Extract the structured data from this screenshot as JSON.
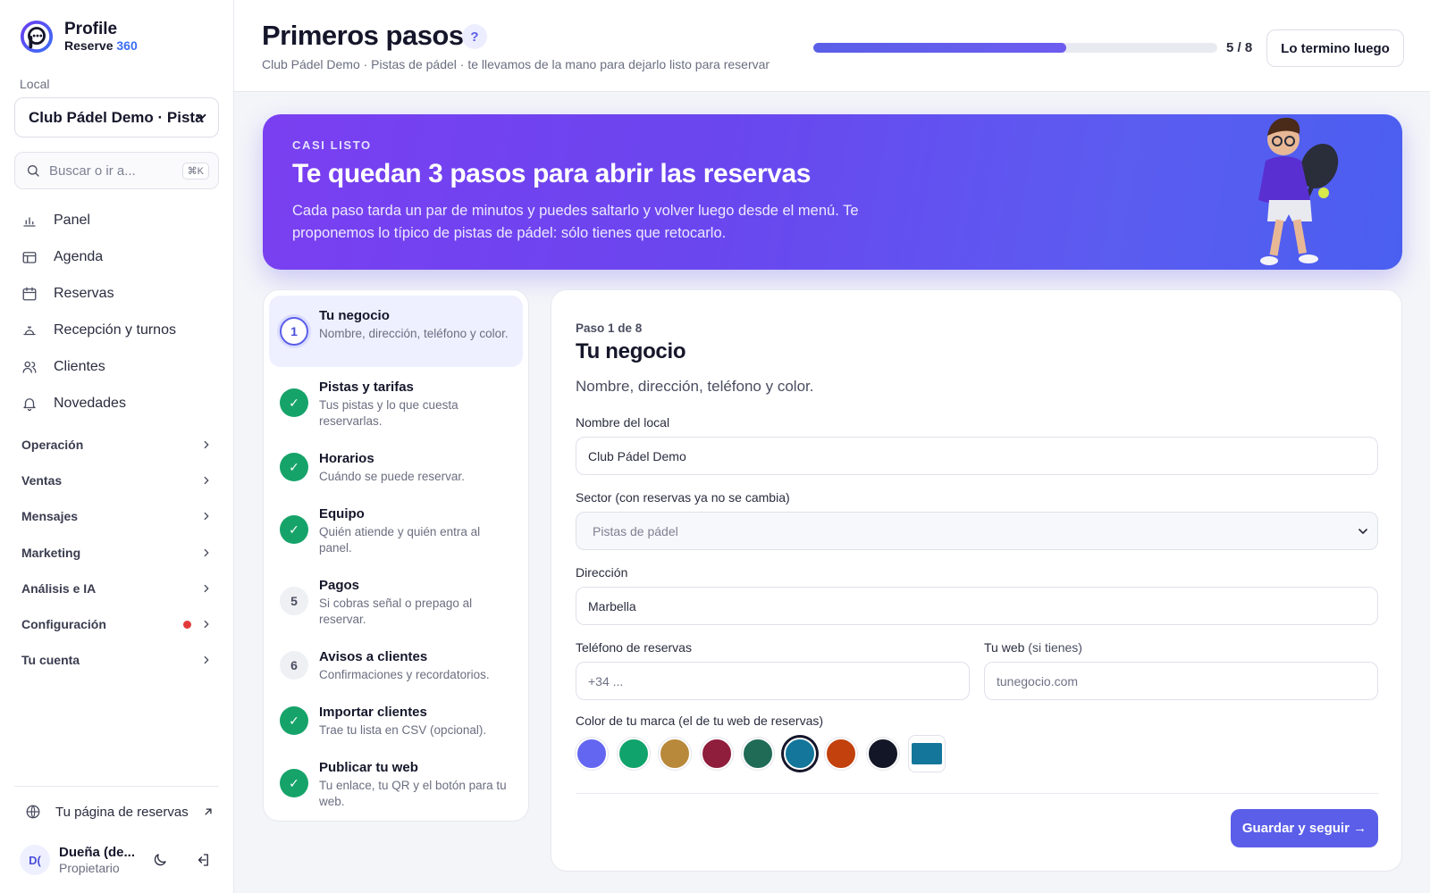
{
  "brand": {
    "name": "Profile",
    "product": "Reserve",
    "version": "360"
  },
  "sidebar": {
    "local_label": "Local",
    "local_value": "Club Pádel Demo · Pista",
    "search_placeholder": "Buscar o ir a...",
    "search_shortcut": "⌘K",
    "nav": [
      {
        "label": "Panel",
        "icon": "bar-chart-icon"
      },
      {
        "label": "Agenda",
        "icon": "table-icon"
      },
      {
        "label": "Reservas",
        "icon": "calendar-icon"
      },
      {
        "label": "Recepción y turnos",
        "icon": "bell-desk-icon"
      },
      {
        "label": "Clientes",
        "icon": "users-icon"
      },
      {
        "label": "Novedades",
        "icon": "bell-icon"
      }
    ],
    "groups": [
      {
        "label": "Operación",
        "alert": false
      },
      {
        "label": "Ventas",
        "alert": false
      },
      {
        "label": "Mensajes",
        "alert": false
      },
      {
        "label": "Marketing",
        "alert": false
      },
      {
        "label": "Análisis e IA",
        "alert": false
      },
      {
        "label": "Configuración",
        "alert": true
      },
      {
        "label": "Tu cuenta",
        "alert": false
      }
    ],
    "booking_page_link": "Tu página de reservas",
    "user": {
      "initials": "D(",
      "name": "Dueña (de...",
      "role": "Propietario"
    }
  },
  "header": {
    "title": "Primeros pasos",
    "help": "?",
    "subtitle": "Club Pádel Demo · Pistas de pádel · te llevamos de la mano para dejarlo listo para reservar",
    "progress": {
      "done": 5,
      "total": 8,
      "label": "5 / 8"
    },
    "later_button": "Lo termino luego"
  },
  "banner": {
    "eyebrow": "CASI LISTO",
    "title": "Te quedan 3 pasos para abrir las reservas",
    "text": "Cada paso tarda un par de minutos y puedes saltarlo y volver luego desde el menú. Te proponemos lo típico de pistas de pádel: sólo tienes que retocarlo."
  },
  "steps": [
    {
      "badge": "1",
      "state": "active",
      "title": "Tu negocio",
      "desc": "Nombre, dirección, teléfono y color."
    },
    {
      "badge": "✓",
      "state": "done",
      "title": "Pistas y tarifas",
      "desc": "Tus pistas y lo que cuesta reservarlas."
    },
    {
      "badge": "✓",
      "state": "done",
      "title": "Horarios",
      "desc": "Cuándo se puede reservar."
    },
    {
      "badge": "✓",
      "state": "done",
      "title": "Equipo",
      "desc": "Quién atiende y quién entra al panel."
    },
    {
      "badge": "5",
      "state": "todo",
      "title": "Pagos",
      "desc": "Si cobras señal o prepago al reservar."
    },
    {
      "badge": "6",
      "state": "todo",
      "title": "Avisos a clientes",
      "desc": "Confirmaciones y recordatorios."
    },
    {
      "badge": "✓",
      "state": "done",
      "title": "Importar clientes",
      "desc": "Trae tu lista en CSV (opcional)."
    },
    {
      "badge": "✓",
      "state": "done",
      "title": "Publicar tu web",
      "desc": "Tu enlace, tu QR y el botón para tu web."
    }
  ],
  "form": {
    "step_of": "Paso 1 de 8",
    "title": "Tu negocio",
    "desc": "Nombre, dirección, teléfono y color.",
    "name_label": "Nombre del local",
    "name_value": "Club Pádel Demo",
    "sector_label": "Sector (con reservas ya no se cambia)",
    "sector_value": "Pistas de pádel",
    "address_label": "Dirección",
    "address_value": "Marbella",
    "phone_label": "Teléfono de reservas",
    "phone_placeholder": "+34 ...",
    "web_label": "Tu web",
    "web_label_note": "(si tienes)",
    "web_placeholder": "tunegocio.com",
    "color_label": "Color de tu marca (el de tu web de reservas)",
    "colors": [
      "#6366f1",
      "#10a36b",
      "#b8893b",
      "#8f1d3c",
      "#1f6b56",
      "#13769a",
      "#c2410c",
      "#121626"
    ],
    "selected_color_index": 5,
    "custom_color": "#13769a",
    "save_button": "Guardar y seguir →"
  }
}
